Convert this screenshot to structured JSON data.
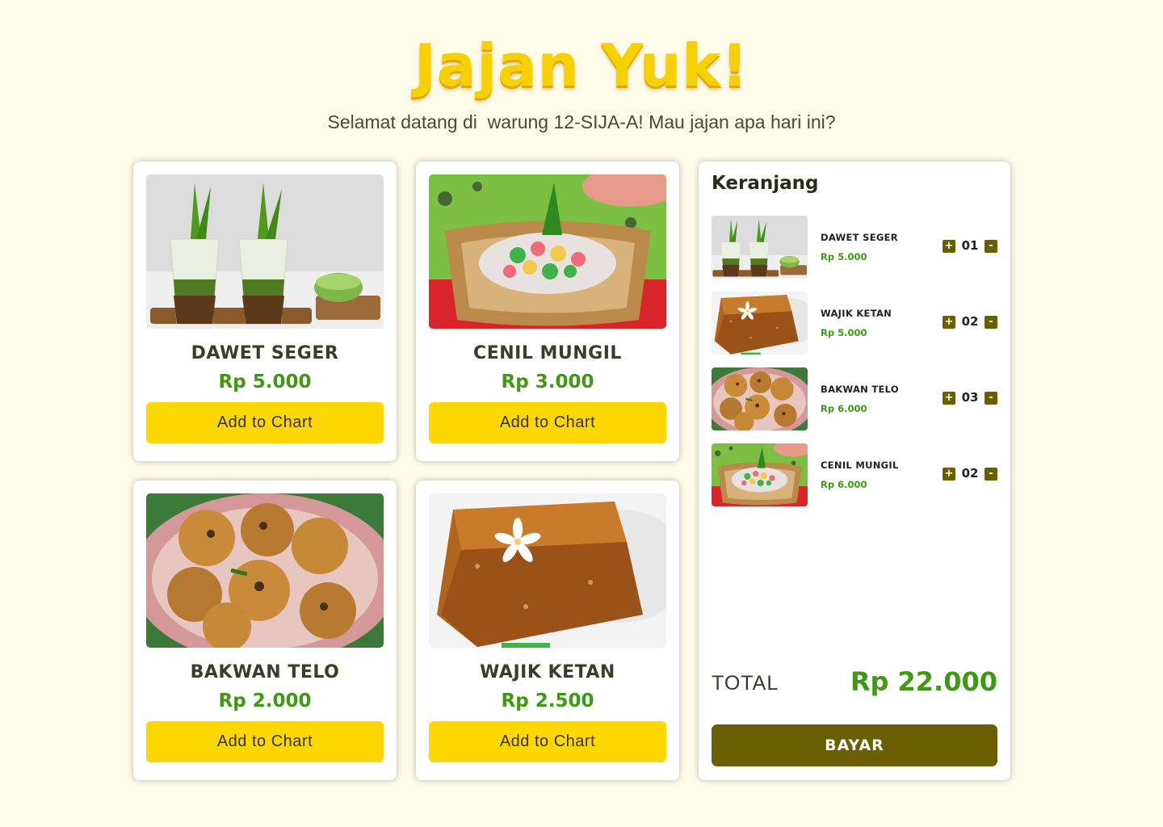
{
  "header": {
    "title": "Jajan Yuk!",
    "subtitle": "Selamat datang di  warung 12-SIJA-A! Mau jajan apa hari ini?"
  },
  "colors": {
    "accent_yellow": "#ffd700",
    "price_green": "#3e9a12",
    "dark_olive": "#6a5f00",
    "background": "#fefbe9"
  },
  "products": [
    {
      "name": "DAWET SEGER",
      "price": "Rp 5.000",
      "button": "Add to Chart",
      "image": "dawet-photo"
    },
    {
      "name": "CENIL MUNGIL",
      "price": "Rp 3.000",
      "button": "Add to Chart",
      "image": "cenil-photo"
    },
    {
      "name": "BAKWAN TELO",
      "price": "Rp 2.000",
      "button": "Add to Chart",
      "image": "bakwan-photo"
    },
    {
      "name": "WAJIK KETAN",
      "price": "Rp 2.500",
      "button": "Add to Chart",
      "image": "wajik-photo"
    }
  ],
  "cart": {
    "title": "Keranjang",
    "items": [
      {
        "name": "DAWET SEGER",
        "price": "Rp 5.000",
        "qty": "01",
        "plus": "+",
        "minus": "-"
      },
      {
        "name": "WAJIK KETAN",
        "price": "Rp 5.000",
        "qty": "02",
        "plus": "+",
        "minus": "-"
      },
      {
        "name": "BAKWAN TELO",
        "price": "Rp 6.000",
        "qty": "03",
        "plus": "+",
        "minus": "-"
      },
      {
        "name": "CENIL MUNGIL",
        "price": "Rp 6.000",
        "qty": "02",
        "plus": "+",
        "minus": "-"
      }
    ],
    "total_label": "TOTAL",
    "total_value": "Rp 22.000",
    "pay_label": "BAYAR"
  }
}
